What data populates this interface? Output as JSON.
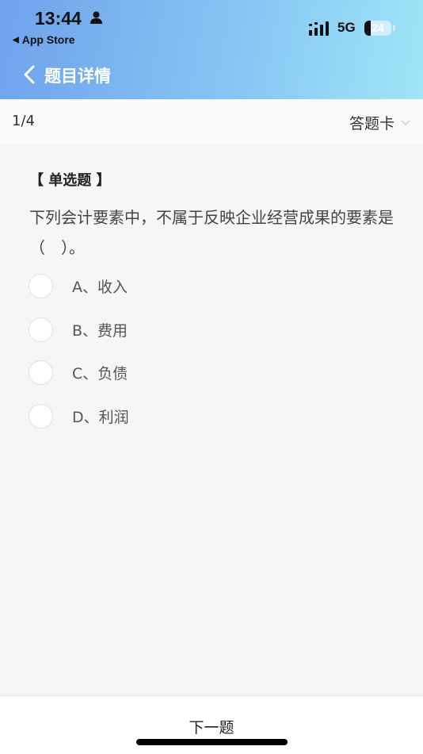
{
  "status_bar": {
    "time": "13:44",
    "back_app": "App Store",
    "network": "5G",
    "battery": "24"
  },
  "nav": {
    "title": "题目详情"
  },
  "progress": {
    "text": "1/4",
    "answer_card_label": "答题卡"
  },
  "question": {
    "type_label": "【 单选题 】",
    "text": "下列会计要素中，不属于反映企业经营成果的要素是（　）。",
    "options": [
      {
        "label": "A、收入"
      },
      {
        "label": "B、费用"
      },
      {
        "label": "C、负债"
      },
      {
        "label": "D、利润"
      }
    ]
  },
  "footer": {
    "next_label": "下一题"
  },
  "colors": {
    "header_start": "#6fa2ec",
    "header_end": "#9fe6f7",
    "background": "#f6f6f6"
  }
}
